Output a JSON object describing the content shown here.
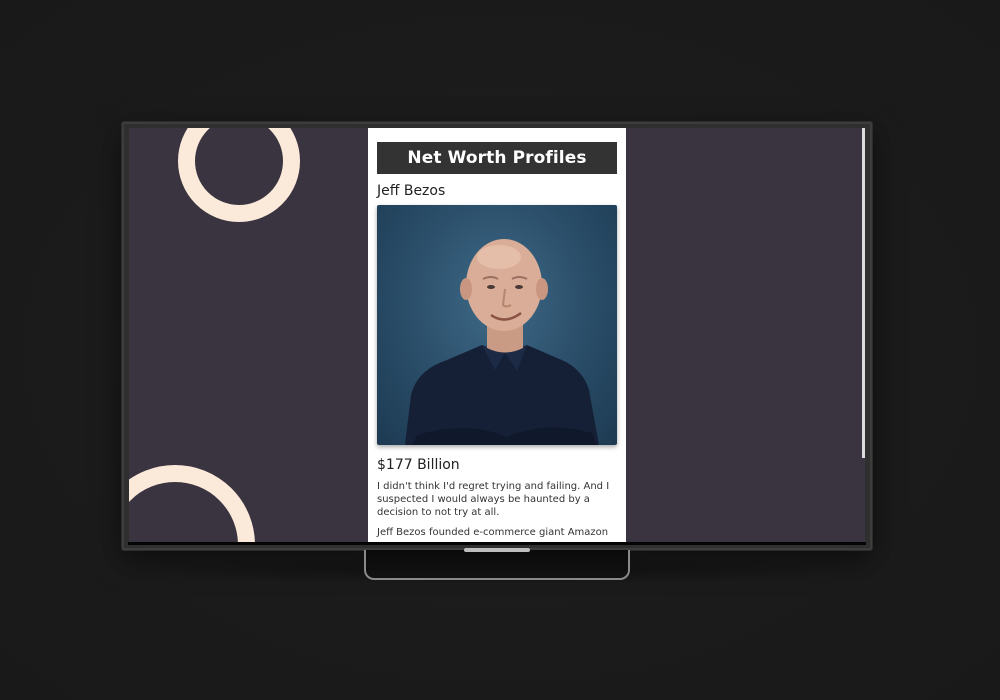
{
  "page": {
    "title": "Net Worth Profiles"
  },
  "profile": {
    "name": "Jeff Bezos",
    "net_worth": "$177 Billion",
    "quote": "I didn't think I'd regret trying and failing. And I suspected I would always be haunted by a decision to not try at all.",
    "bio_start": "Jeff Bezos founded e-commerce giant Amazon",
    "photo_icon": "portrait-photo"
  },
  "colors": {
    "background": "#3a3440",
    "panel": "#ffffff",
    "header": "#333333",
    "ring": "#fbe9da"
  }
}
